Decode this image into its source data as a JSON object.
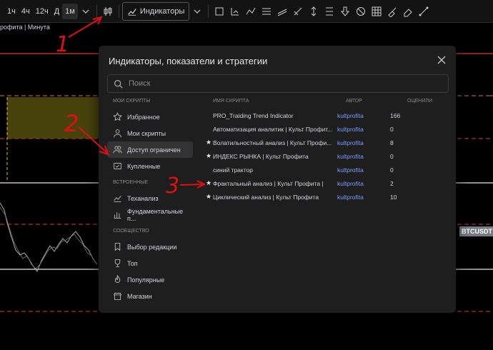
{
  "toolbar": {
    "timeframes": [
      "1ч",
      "4ч",
      "12ч",
      "Д",
      "1м"
    ],
    "active_timeframe": "1м",
    "indicators_label": "Индикаторы"
  },
  "chart": {
    "title": "рофита | Минута",
    "price_tag": "BTCUSDT"
  },
  "modal": {
    "title": "Индикаторы, показатели и стратегии",
    "search_placeholder": "Поиск",
    "sidebar": {
      "my_scripts_header": "МОИ СКРИПТЫ",
      "my_scripts": [
        {
          "label": "Избранное",
          "icon": "star-icon"
        },
        {
          "label": "Мои скрипты",
          "icon": "user-icon"
        },
        {
          "label": "Доступ ограничен",
          "icon": "users-icon",
          "active": true
        },
        {
          "label": "Купленные",
          "icon": "bought-icon"
        }
      ],
      "builtin_header": "ВСТРОЕННЫЕ",
      "builtin": [
        {
          "label": "Теханализ",
          "icon": "chart-icon"
        },
        {
          "label": "Фундаментальные п...",
          "icon": "bars-icon"
        }
      ],
      "community_header": "СООБЩЕСТВО",
      "community": [
        {
          "label": "Выбор редакции",
          "icon": "bookmark-icon"
        },
        {
          "label": "Топ",
          "icon": "trophy-icon"
        },
        {
          "label": "Популярные",
          "icon": "fire-icon"
        },
        {
          "label": "Магазин",
          "icon": "shop-icon"
        }
      ]
    },
    "table": {
      "headers": {
        "name": "ИМЯ СКРИПТА",
        "author": "АВТОР",
        "rating": "ОЦЕНИЛИ"
      },
      "rows": [
        {
          "star": false,
          "name": "PRO_Traiding Trend Indicator",
          "author": "kultprofita",
          "rating": "166"
        },
        {
          "star": false,
          "name": "Автоматизация аналитик | Культ Профит...",
          "author": "kultprofita",
          "rating": "0"
        },
        {
          "star": true,
          "name": "Волатильностный анализ | Культ Профи...",
          "author": "kultprofita",
          "rating": "8"
        },
        {
          "star": true,
          "name": "ИНДЕКС РЫНКА | Культ Профита",
          "author": "kultprofita",
          "rating": "0"
        },
        {
          "star": false,
          "name": "синий трактор",
          "author": "kultprofita",
          "rating": "0"
        },
        {
          "star": true,
          "name": "Фрактальный анализ | Культ Профита |",
          "author": "kultprofita",
          "rating": "2"
        },
        {
          "star": true,
          "name": "Циклический анализ | Культ Профита",
          "author": "kultprofita",
          "rating": "10"
        }
      ]
    }
  },
  "annotations": [
    "1",
    "2",
    "3"
  ],
  "colors": {
    "accent_link": "#7b9cff",
    "annotation": "#e01010",
    "level_red": "#e03a3a",
    "zone": "#5a5210"
  }
}
